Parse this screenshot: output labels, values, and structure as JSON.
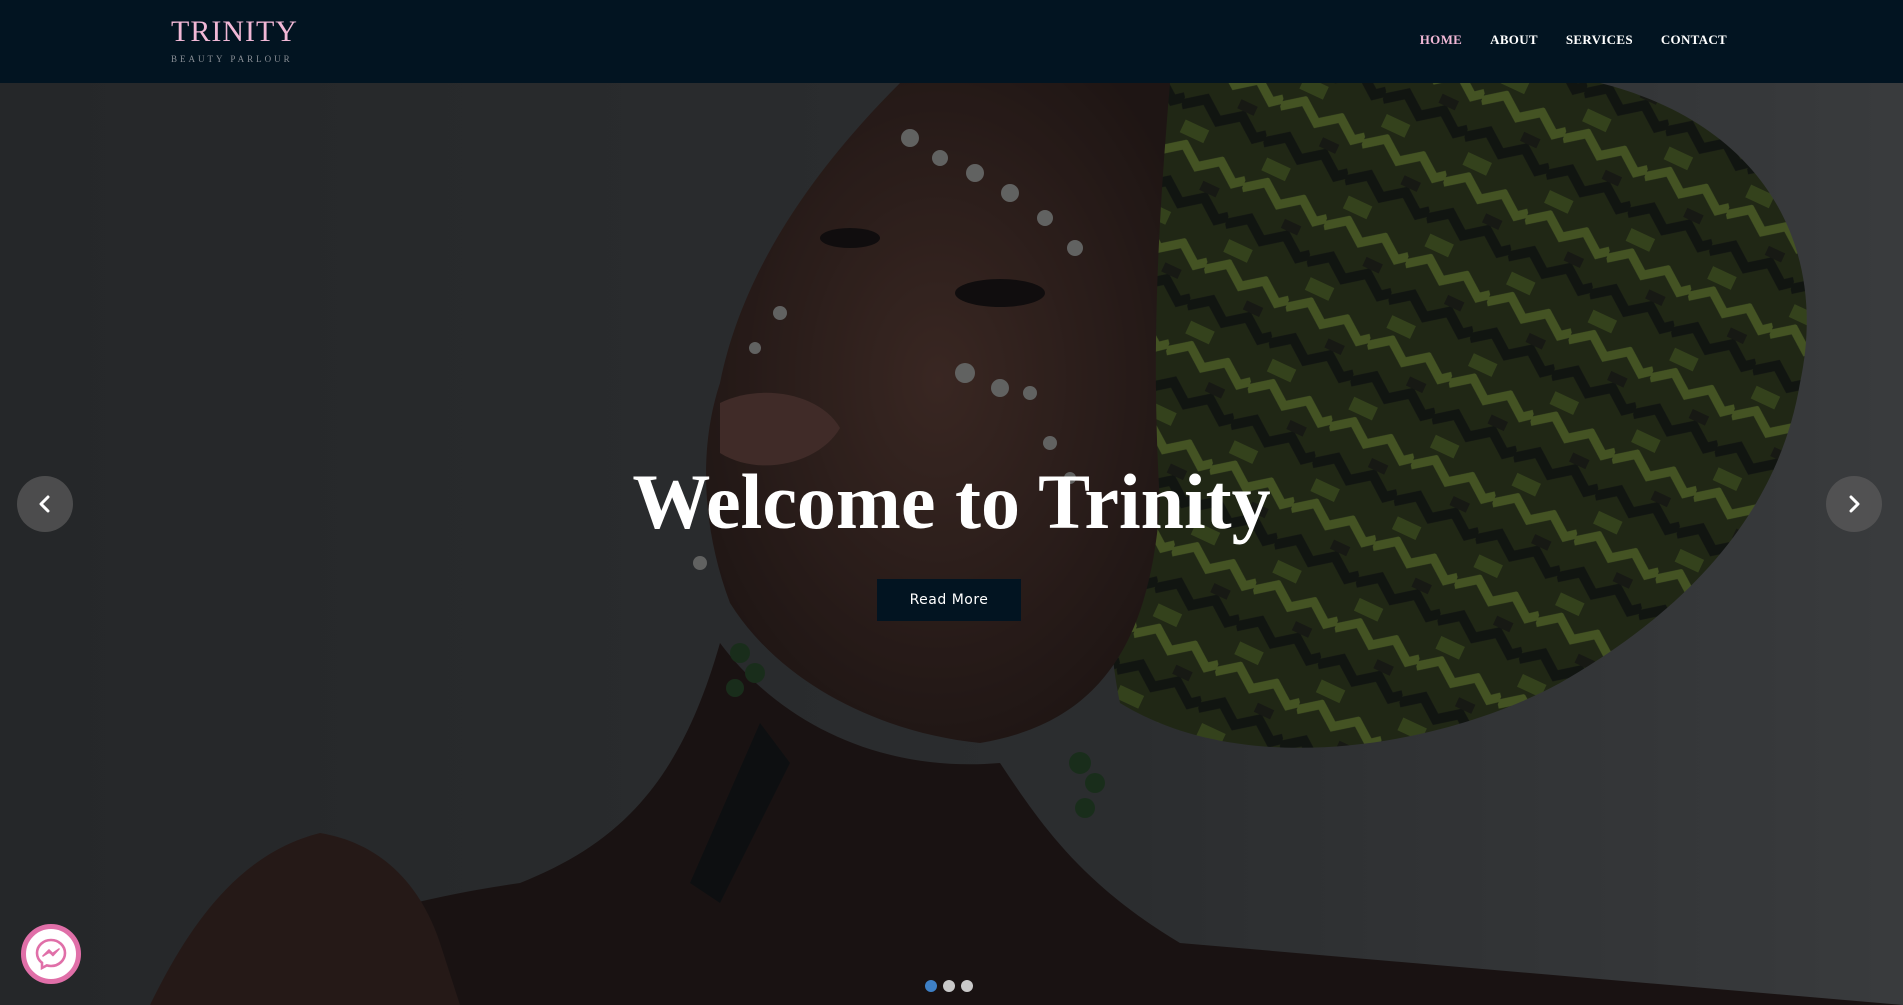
{
  "brand": {
    "name": "TRINITY",
    "tagline": "BEAUTY PARLOUR"
  },
  "nav": {
    "items": [
      {
        "label": "HOME",
        "active": true
      },
      {
        "label": "ABOUT",
        "active": false
      },
      {
        "label": "SERVICES",
        "active": false
      },
      {
        "label": "CONTACT",
        "active": false
      }
    ]
  },
  "hero": {
    "title": "Welcome to Trinity",
    "button_label": "Read More",
    "slide_count": 3,
    "active_slide": 1
  },
  "icons": {
    "prev": "chevron-left-icon",
    "next": "chevron-right-icon",
    "chat": "messenger-icon"
  },
  "colors": {
    "navbar": "#021421",
    "brand_accent": "#f1b8d6",
    "active_dot": "#3e80c6",
    "chat_ring": "#e06fa8"
  }
}
